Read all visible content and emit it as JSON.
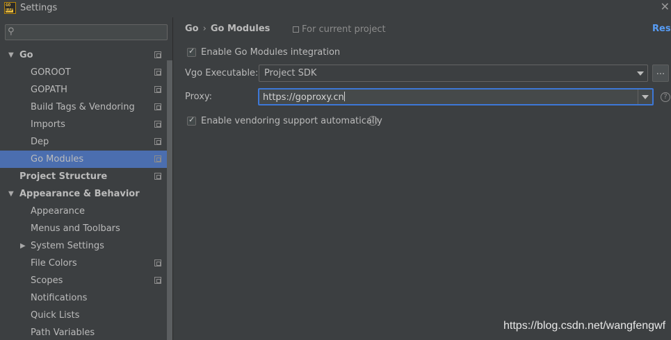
{
  "window": {
    "title": "Settings",
    "icon_text_top": "GO",
    "icon_text_bottom": "EAP",
    "close_icon": "close-icon"
  },
  "search": {
    "placeholder": "",
    "icon": "search-icon"
  },
  "sidebar": {
    "items": [
      {
        "label": "Go",
        "level": 0,
        "bold": true,
        "expanded": true,
        "project_icon": true
      },
      {
        "label": "GOROOT",
        "level": 1,
        "project_icon": true
      },
      {
        "label": "GOPATH",
        "level": 1,
        "project_icon": true
      },
      {
        "label": "Build Tags & Vendoring",
        "level": 1,
        "project_icon": true
      },
      {
        "label": "Imports",
        "level": 1,
        "project_icon": true
      },
      {
        "label": "Dep",
        "level": 1,
        "project_icon": true
      },
      {
        "label": "Go Modules",
        "level": 1,
        "project_icon": true,
        "selected": true
      },
      {
        "label": "Project Structure",
        "level": 0,
        "bold": true,
        "project_icon": true
      },
      {
        "label": "Appearance & Behavior",
        "level": 0,
        "bold": true,
        "expanded": true
      },
      {
        "label": "Appearance",
        "level": 1
      },
      {
        "label": "Menus and Toolbars",
        "level": 1
      },
      {
        "label": "System Settings",
        "level": 1,
        "collapsed": true
      },
      {
        "label": "File Colors",
        "level": 1,
        "project_icon": true
      },
      {
        "label": "Scopes",
        "level": 1,
        "project_icon": true
      },
      {
        "label": "Notifications",
        "level": 1
      },
      {
        "label": "Quick Lists",
        "level": 1
      },
      {
        "label": "Path Variables",
        "level": 1
      }
    ]
  },
  "main": {
    "breadcrumb": {
      "parent": "Go",
      "separator": "›",
      "current": "Go Modules"
    },
    "scope_note": "For current project",
    "reset_label": "Rese",
    "enable_modules": {
      "label": "Enable Go Modules integration",
      "checked": true
    },
    "vgo": {
      "label": "Vgo Executable:",
      "value": "Project SDK",
      "browse_label": "..."
    },
    "proxy": {
      "label": "Proxy:",
      "value": "https://goproxy.cn"
    },
    "enable_vendoring": {
      "label": "Enable vendoring support automatically",
      "checked": true
    },
    "help_glyph": "?"
  },
  "watermark": "https://blog.csdn.net/wangfengwf",
  "colors": {
    "background": "#3c3f41",
    "selection": "#4b6eaf",
    "focus_border": "#3d78d8",
    "link": "#589df6"
  }
}
